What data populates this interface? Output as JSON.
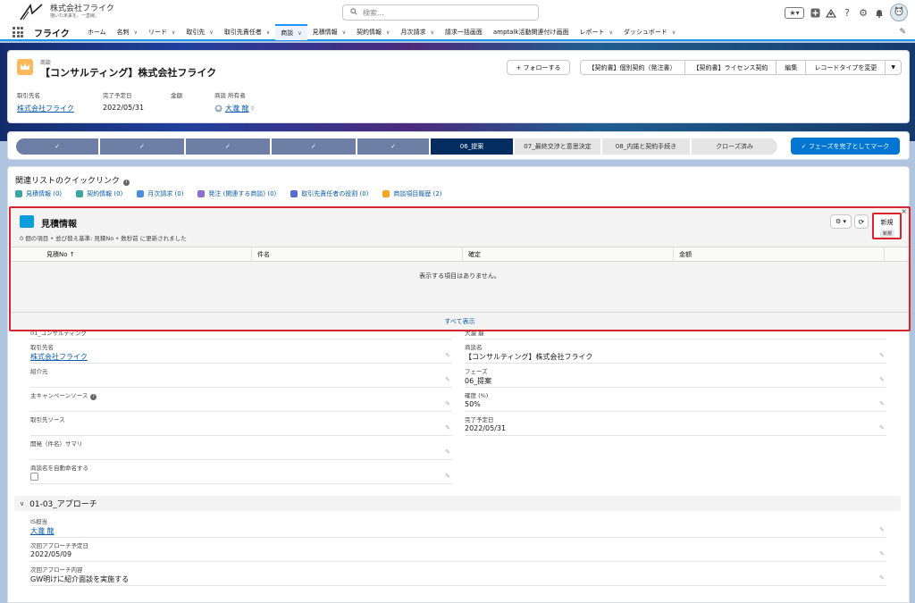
{
  "header": {
    "company_name": "株式会社フライク",
    "company_tagline": "描いた未来を、一直線。",
    "search_placeholder": "検索..."
  },
  "nav": {
    "app_name": "フライク",
    "items": [
      {
        "label": "ホーム",
        "chevron": false
      },
      {
        "label": "名刺",
        "chevron": true
      },
      {
        "label": "リード",
        "chevron": true
      },
      {
        "label": "取引先",
        "chevron": true
      },
      {
        "label": "取引先責任者",
        "chevron": true
      },
      {
        "label": "商談",
        "chevron": true,
        "active": true
      },
      {
        "label": "見積情報",
        "chevron": true
      },
      {
        "label": "契約情報",
        "chevron": true
      },
      {
        "label": "月次請求",
        "chevron": true
      },
      {
        "label": "請求一括画面",
        "chevron": false
      },
      {
        "label": "amptalk活動関連付け画面",
        "chevron": false
      },
      {
        "label": "レポート",
        "chevron": true
      },
      {
        "label": "ダッシュボード",
        "chevron": true
      }
    ]
  },
  "record": {
    "object_type": "商談",
    "title": "【コンサルティング】株式会社フライク",
    "actions": {
      "follow": "+ フォローする",
      "group": [
        "【契約書】個別契約（発注書）",
        "【契約書】ライセンス契約",
        "編集",
        "レコードタイプを変更"
      ],
      "more": "▼"
    },
    "highlights": [
      {
        "label": "取引先名",
        "value": "株式会社フライク",
        "link": true
      },
      {
        "label": "完了予定日",
        "value": "2022/05/31",
        "link": false
      },
      {
        "label": "金額",
        "value": "",
        "link": false
      },
      {
        "label": "商談 所有者",
        "value": "大瀧 龍",
        "link": true
      }
    ]
  },
  "path": {
    "steps": [
      {
        "label": "✓",
        "state": "done"
      },
      {
        "label": "✓",
        "state": "done"
      },
      {
        "label": "✓",
        "state": "done"
      },
      {
        "label": "✓",
        "state": "done"
      },
      {
        "label": "✓",
        "state": "done"
      },
      {
        "label": "06_提案",
        "state": "current"
      },
      {
        "label": "07_最終交渉と意思決定",
        "state": "todo"
      },
      {
        "label": "08_内諾と契約手続き",
        "state": "todo"
      },
      {
        "label": "クローズ済み",
        "state": "todo"
      }
    ],
    "mark_complete": "✓ フェーズを完了としてマーク"
  },
  "quick_links": {
    "title": "関連リストのクイックリンク",
    "links": [
      {
        "label": "見積情報 (0)",
        "color": "#3ba7a0"
      },
      {
        "label": "契約情報 (0)",
        "color": "#3ba7a0"
      },
      {
        "label": "月次請求 (0)",
        "color": "#4d8de0"
      },
      {
        "label": "発注 (関連する商談) (0)",
        "color": "#8c6fd1"
      },
      {
        "label": "取引先責任者の役割 (0)",
        "color": "#5a6bd8"
      },
      {
        "label": "商談項目履歴 (2)",
        "color": "#f5a623"
      }
    ]
  },
  "popup": {
    "title": "見積情報",
    "subtitle": "0 個の項目 • 並び替え基準: 見積No • 数秒前 に更新されました",
    "gear": "⚙ ▾",
    "refresh": "⟳",
    "new_button": "新規",
    "new_tooltip": "新規",
    "close": "×",
    "columns": [
      "見積No ↑",
      "件名",
      "確定",
      "金額"
    ],
    "empty_message": "表示する項目はありません。",
    "view_all": "すべて表示"
  },
  "details": {
    "left": [
      {
        "label": "01_コンサルティング",
        "value": "",
        "partial": true
      },
      {
        "label": "取引先名",
        "value": "株式会社フライク",
        "link": true
      },
      {
        "label": "紹介元",
        "value": ""
      },
      {
        "label": "主キャンペーンソース",
        "value": "",
        "info": true
      },
      {
        "label": "取引先ソース",
        "value": ""
      },
      {
        "label": "開発（件名）サマリ",
        "value": ""
      },
      {
        "label": "商談名を自動命名する",
        "value": "",
        "checkbox": true
      }
    ],
    "right": [
      {
        "label": "大瀧 龍",
        "value": "",
        "partial": true
      },
      {
        "label": "商談名",
        "value": "【コンサルティング】株式会社フライク"
      },
      {
        "label": "フェーズ",
        "value": "06_提案"
      },
      {
        "label": "確度 (%)",
        "value": "50%"
      },
      {
        "label": "完了予定日",
        "value": "2022/05/31"
      }
    ],
    "section": {
      "title": "01-03_アプローチ",
      "fields": [
        {
          "label": "IS担当",
          "value": "大瀧 龍",
          "link": true
        },
        {
          "label": "次回アプローチ予定日",
          "value": "2022/05/09"
        },
        {
          "label": "次回アプローチ内容",
          "value": "GW明けに紹介面談を実施する"
        }
      ]
    }
  }
}
